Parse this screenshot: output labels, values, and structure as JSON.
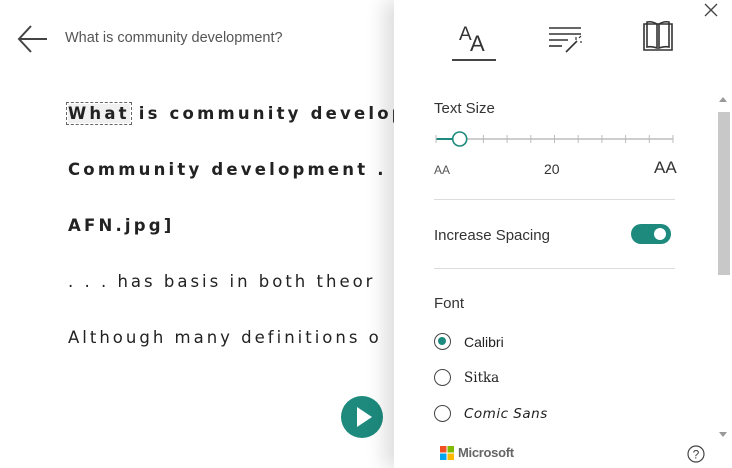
{
  "reader": {
    "title": "What is community development?",
    "lines": [
      {
        "focus_word": "What",
        "rest": " is community develop"
      },
      {
        "text": "Community development . ."
      },
      {
        "text": "AFN.jpg]"
      },
      {
        "text": ". . . has basis in both theor"
      },
      {
        "text": "Although many definitions o"
      }
    ],
    "icons": {
      "back": "back-arrow-icon",
      "play": "play-icon"
    }
  },
  "panel": {
    "tabs": [
      {
        "id": "text-preferences",
        "icon": "text-size-icon",
        "active": true
      },
      {
        "id": "grammar-options",
        "icon": "grammar-wand-icon",
        "active": false
      },
      {
        "id": "reading-preferences",
        "icon": "book-icon",
        "active": false
      }
    ],
    "text_size": {
      "label": "Text Size",
      "value": "20",
      "small_glyph": "AA",
      "large_glyph": "AA",
      "slider_fraction": 0.1,
      "tick_count": 11
    },
    "spacing": {
      "label": "Increase Spacing",
      "enabled": true
    },
    "font": {
      "label": "Font",
      "options": [
        {
          "label": "Calibri",
          "selected": true
        },
        {
          "label": "Sitka",
          "selected": false
        },
        {
          "label": "Comic Sans",
          "selected": false
        }
      ]
    },
    "brand": "Microsoft",
    "help_label": "?",
    "colors": {
      "accent": "#1d8a7d",
      "ms_red": "#f25022",
      "ms_green": "#7fba00",
      "ms_blue": "#00a4ef",
      "ms_yellow": "#ffb900"
    }
  }
}
